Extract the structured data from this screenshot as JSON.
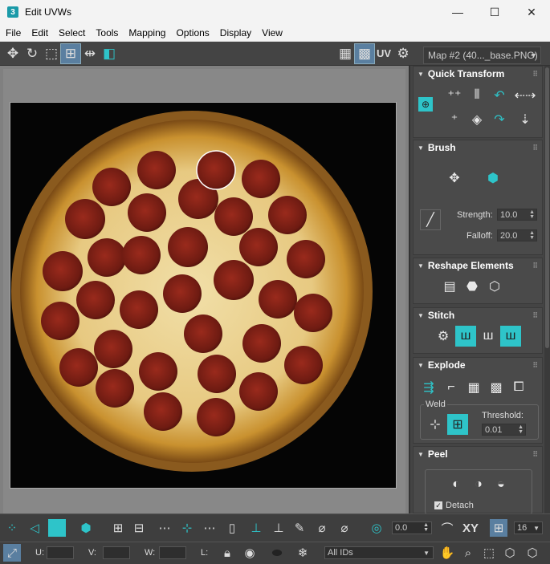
{
  "window": {
    "title": "Edit UVWs",
    "app_icon": "3",
    "minimize": "—",
    "maximize": "☐",
    "close": "✕"
  },
  "menu": [
    "File",
    "Edit",
    "Select",
    "Tools",
    "Mapping",
    "Options",
    "Display",
    "View"
  ],
  "toolbar": {
    "uv_label": "UV",
    "map_select": "Map #2 (40..._base.PNG)"
  },
  "panel": {
    "quick_transform": {
      "title": "Quick Transform"
    },
    "brush": {
      "title": "Brush",
      "strength_label": "Strength:",
      "strength_value": "10.0",
      "falloff_label": "Falloff:",
      "falloff_value": "20.0"
    },
    "reshape": {
      "title": "Reshape Elements"
    },
    "stitch": {
      "title": "Stitch"
    },
    "explode": {
      "title": "Explode",
      "weld_label": "Weld",
      "threshold_label": "Threshold:",
      "threshold_value": "0.01"
    },
    "peel": {
      "title": "Peel",
      "detach_label": "Detach"
    }
  },
  "bottom": {
    "angle_value": "0.0",
    "xy_label": "XY",
    "grid_value": "16",
    "u_label": "U:",
    "v_label": "V:",
    "w_label": "W:",
    "l_label": "L:",
    "ids_select": "All IDs"
  },
  "colors": {
    "accent": "#2ec4c9",
    "panel_bg": "#444444",
    "viewport_bg": "#808080"
  }
}
